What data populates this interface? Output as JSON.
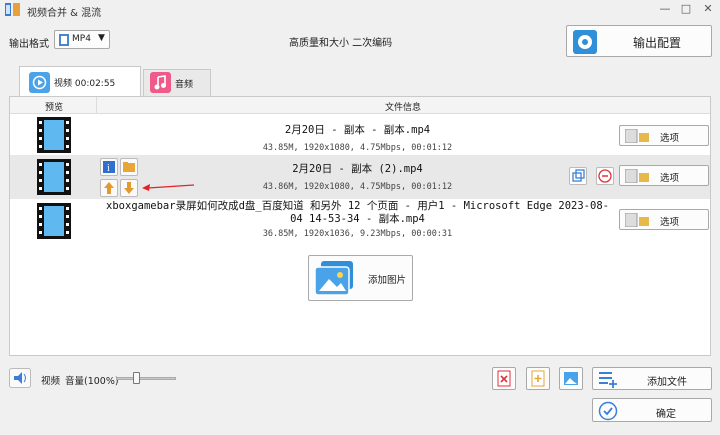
{
  "window": {
    "title": "视频合并 & 混流",
    "minimize": "—",
    "maximize": "□",
    "close": "✕"
  },
  "toolbar": {
    "format_label": "输出格式",
    "format_value": "MP4",
    "quality_text": "高质量和大小 二次编码",
    "output_config": "输出配置"
  },
  "tabs": [
    {
      "label": "视频 00:02:55",
      "icon": "play-icon"
    },
    {
      "label": "音频",
      "icon": "music-note-icon"
    }
  ],
  "table": {
    "col_preview": "预览",
    "col_info": "文件信息"
  },
  "files": [
    {
      "name": "2月20日 - 副本 - 副本.mp4",
      "meta": "43.85M, 1920x1080, 4.75Mbps, 00:01:12",
      "option": "选项"
    },
    {
      "name": "2月20日 - 副本 (2).mp4",
      "meta": "43.86M, 1920x1080, 4.75Mbps, 00:01:12",
      "option": "选项"
    },
    {
      "name": "xboxgamebar录屏如何改成d盘_百度知道 和另外 12 个页面 - 用户1 - Microsoft Edge 2023-08-04 14-53-34 - 副本.mp4",
      "meta": "36.85M, 1920x1036, 9.23Mbps, 00:00:31",
      "option": "选项"
    }
  ],
  "add_picture": "添加图片",
  "bottom": {
    "video_label": "视频",
    "volume_label": "音量(100%)",
    "volume_level": 0.28,
    "add_file": "添加文件",
    "confirm": "确定"
  }
}
